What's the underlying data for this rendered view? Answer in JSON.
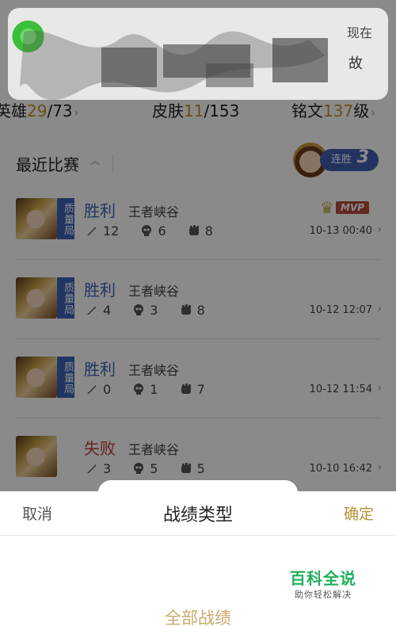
{
  "stats": {
    "heroes": {
      "label": "英雄",
      "value": "29",
      "total": "/73"
    },
    "skins": {
      "label": "皮肤",
      "value": "11",
      "total": "/153"
    },
    "inscription": {
      "label": "铭文",
      "value": "137",
      "suffix": "级"
    }
  },
  "recent": {
    "title": "最近比赛",
    "streak_label": "连胜",
    "streak_count": "3"
  },
  "matches": [
    {
      "result": "胜利",
      "map": "王者峡谷",
      "mode": "质量局",
      "kills": "12",
      "deaths": "6",
      "assists": "8",
      "time": "10-13 00:40",
      "mvp": "MVP"
    },
    {
      "result": "胜利",
      "map": "王者峡谷",
      "mode": "质量局",
      "kills": "4",
      "deaths": "3",
      "assists": "8",
      "time": "10-12 12:07"
    },
    {
      "result": "胜利",
      "map": "王者峡谷",
      "mode": "质量局",
      "kills": "0",
      "deaths": "1",
      "assists": "7",
      "time": "10-12 11:54"
    },
    {
      "result": "失败",
      "map": "王者峡谷",
      "kills": "3",
      "deaths": "5",
      "assists": "5",
      "time": "10-10 16:42"
    }
  ],
  "notification": {
    "time": "现在",
    "body": "故"
  },
  "sheet": {
    "cancel": "取消",
    "title": "战绩类型",
    "confirm": "确定",
    "option": "全部战绩"
  },
  "watermark": {
    "main": "百科全说",
    "sub": "助你轻松解决"
  },
  "colors": {
    "win": "#3e63b8",
    "lose": "#c23b3b",
    "accent": "#b8913a",
    "watermark": "#1fb05a"
  }
}
